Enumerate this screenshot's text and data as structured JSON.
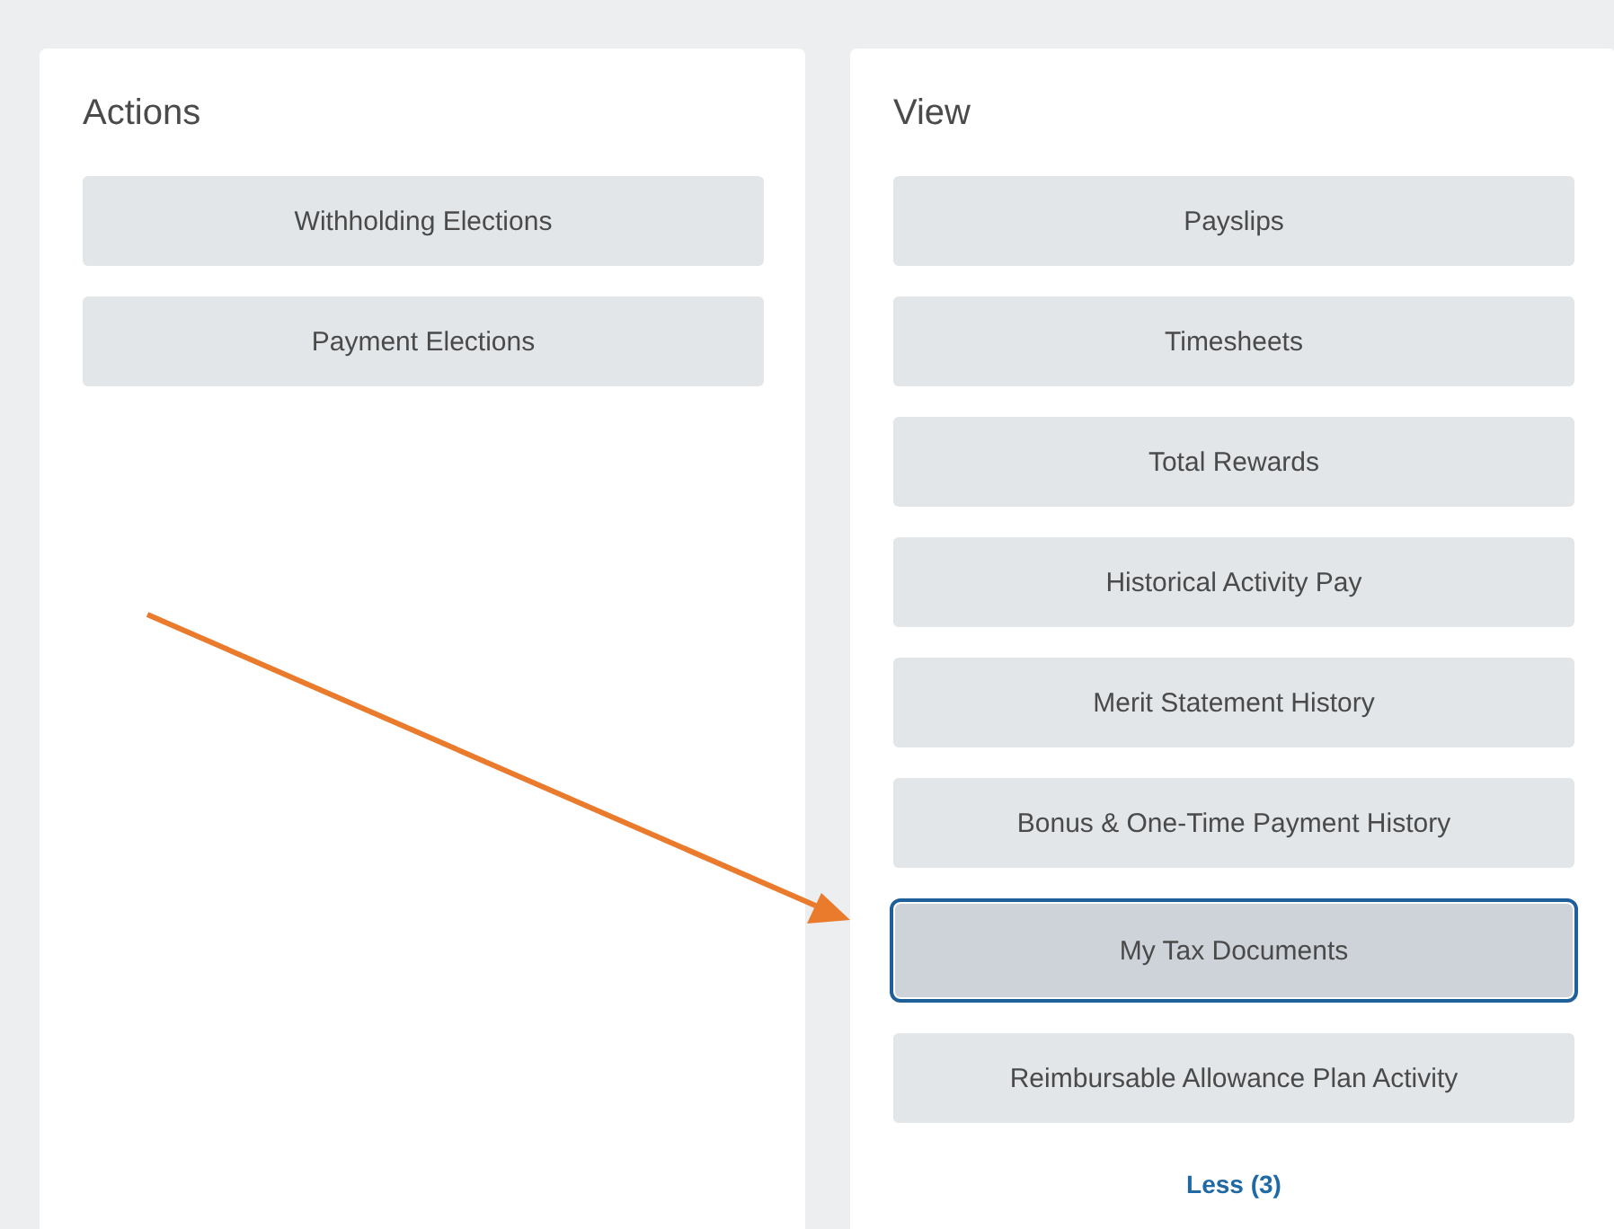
{
  "panels": [
    {
      "title": "Actions",
      "buttons": [
        {
          "label": "Withholding Elections",
          "selected": false
        },
        {
          "label": "Payment Elections",
          "selected": false
        }
      ]
    },
    {
      "title": "View",
      "buttons": [
        {
          "label": "Payslips",
          "selected": false
        },
        {
          "label": "Timesheets",
          "selected": false
        },
        {
          "label": "Total Rewards",
          "selected": false
        },
        {
          "label": "Historical Activity Pay",
          "selected": false
        },
        {
          "label": "Merit Statement History",
          "selected": false
        },
        {
          "label": "Bonus & One-Time Payment History",
          "selected": false
        },
        {
          "label": "My Tax Documents",
          "selected": true
        },
        {
          "label": "Reimbursable Allowance Plan Activity",
          "selected": false
        }
      ],
      "link": "Less (3)"
    }
  ]
}
